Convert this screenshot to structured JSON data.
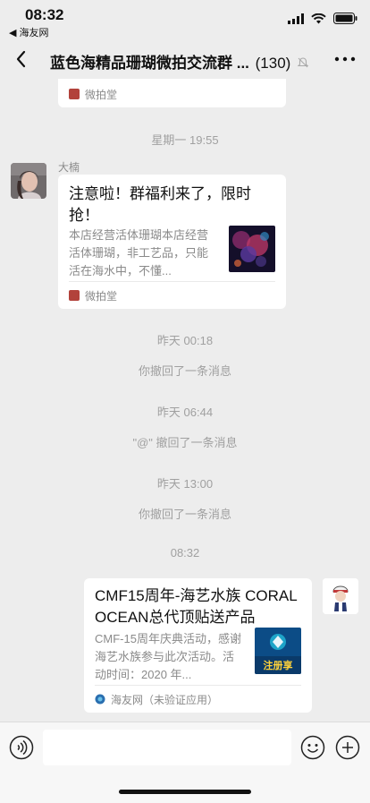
{
  "status_bar": {
    "time": "08:32",
    "back_app": "◀ 海友网"
  },
  "nav": {
    "title": "蓝色海精品珊瑚微拍交流群 ...",
    "count": "(130)"
  },
  "chat": {
    "top_card_source": "微拍堂",
    "ts1": "星期一 19:55",
    "msg1": {
      "sender": "大楠",
      "title": "注意啦！群福利来了，限时抢！",
      "desc": "本店经营活体珊瑚本店经营活体珊瑚，非工艺品，只能活在海水中，不懂...",
      "source": "微拍堂"
    },
    "ts2": "昨天 00:18",
    "sys1": "你撤回了一条消息",
    "ts3": "昨天 06:44",
    "sys2": "\"@\" 撤回了一条消息",
    "ts4": "昨天 13:00",
    "sys3": "你撤回了一条消息",
    "ts5": "08:32",
    "msg2": {
      "title": "CMF15周年-海艺水族 CORAL OCEAN总代顶贴送产品",
      "desc": "CMF-15周年庆典活动，感谢海艺水族参与此次活动。活动时间：2020 年...",
      "source": "海友网（未验证应用）",
      "thumb_text": "注册享"
    }
  },
  "colors": {
    "bg": "#ededed",
    "card": "#ffffff",
    "muted": "#a0a0a0",
    "source_red": "#b2423b"
  }
}
